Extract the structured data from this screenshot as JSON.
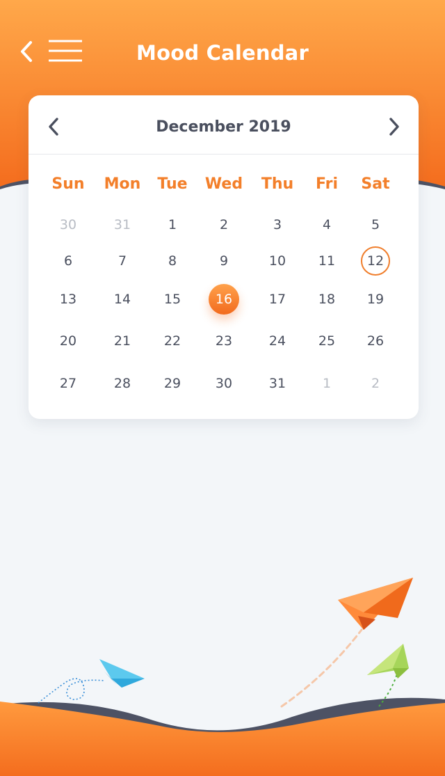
{
  "header": {
    "title": "Mood Calendar",
    "colors": {
      "gradient_top": "#ffa84a",
      "gradient_bottom": "#f5721f",
      "text": "#ffffff"
    }
  },
  "calendar": {
    "month_label": "December 2019",
    "weekdays": [
      "Sun",
      "Mon",
      "Tue",
      "Wed",
      "Thu",
      "Fri",
      "Sat"
    ],
    "weeks": [
      [
        {
          "d": "30",
          "m": true
        },
        {
          "d": "31",
          "m": true
        },
        {
          "d": "1"
        },
        {
          "d": "2"
        },
        {
          "d": "3"
        },
        {
          "d": "4"
        },
        {
          "d": "5"
        }
      ],
      [
        {
          "d": "6"
        },
        {
          "d": "7"
        },
        {
          "d": "8"
        },
        {
          "d": "9"
        },
        {
          "d": "10"
        },
        {
          "d": "11"
        },
        {
          "d": "12",
          "today": true
        }
      ],
      [
        {
          "d": "13"
        },
        {
          "d": "14"
        },
        {
          "d": "15"
        },
        {
          "d": "16",
          "selected": true
        },
        {
          "d": "17"
        },
        {
          "d": "18"
        },
        {
          "d": "19"
        }
      ],
      [
        {
          "d": "20"
        },
        {
          "d": "21"
        },
        {
          "d": "22"
        },
        {
          "d": "23"
        },
        {
          "d": "24"
        },
        {
          "d": "25"
        },
        {
          "d": "26"
        }
      ],
      [
        {
          "d": "27"
        },
        {
          "d": "28"
        },
        {
          "d": "29"
        },
        {
          "d": "30"
        },
        {
          "d": "31"
        },
        {
          "d": "1",
          "m": true
        },
        {
          "d": "2",
          "m": true
        }
      ]
    ],
    "colors": {
      "accent": "#f37f2a",
      "text": "#4a4f5e",
      "muted": "#b8bcc4"
    }
  },
  "icons": {
    "back": "chevron-left-icon",
    "menu": "hamburger-menu-icon",
    "prev": "chevron-left-icon",
    "next": "chevron-right-icon"
  }
}
